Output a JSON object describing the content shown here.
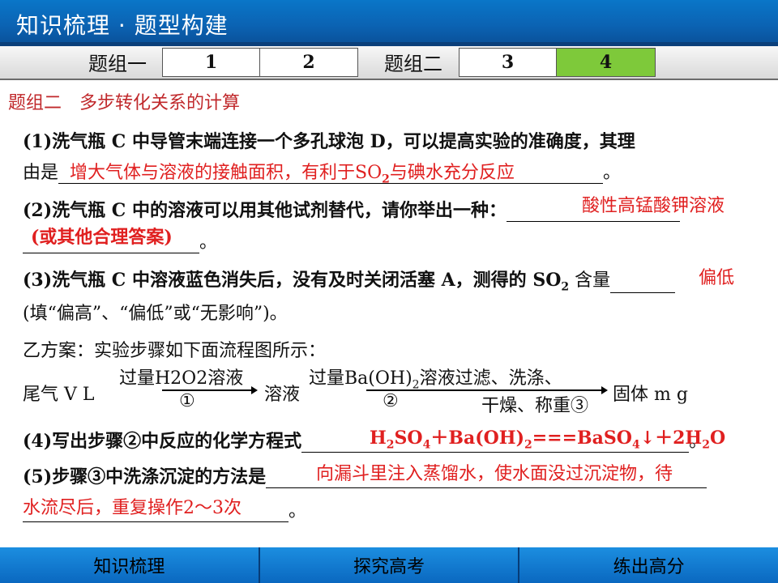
{
  "header": {
    "title": "知识梳理 · 题型构建"
  },
  "tabs": {
    "group1": "题组一",
    "t1": "1",
    "t2": "2",
    "group2": "题组二",
    "t3": "3",
    "t4": "4"
  },
  "section_title": "题组二　多步转化关系的计算",
  "q1": {
    "line1": "(1)洗气瓶 C 中导管末端连接一个多孔球泡 D，可以提高实验的准确度，其理",
    "line2_prefix": "由是",
    "answer_part1": "增大气体与溶液的接触面积，有利于SO",
    "answer_sub": "2",
    "answer_part2": "与碘水充分反应",
    "end": "。"
  },
  "q2": {
    "line1": "(2)洗气瓶 C 中的溶液可以用其他试剂替代，请你举出一种：",
    "answer1": "酸性高锰酸钾溶液",
    "answer2": "(或其他合理答案)",
    "end": "。"
  },
  "q3": {
    "line1": "(3)洗气瓶 C 中溶液蓝色消失后，没有及时关闭活塞 A，测得的 SO",
    "sub": "2",
    "tail": " 含量",
    "answer": "偏低",
    "line2": "(填“偏高”、“偏低”或“无影响”)。"
  },
  "plan_b": "乙方案：实验步骤如下面流程图所示：",
  "flow": {
    "start": "尾气 V L",
    "reagent1": "过量H2O2溶液",
    "step1": "①",
    "mid": "溶液",
    "reagent2_prefix": "过量Ba(OH)",
    "reagent2_sub": "2",
    "reagent2_suffix": "溶液过滤、洗涤、",
    "step2": "②",
    "dry": "干燥、称重③",
    "end": "固体 m g"
  },
  "q4": {
    "line1": "(4)写出步骤②中反应的化学方程式",
    "answer_html_parts": [
      "H",
      "2",
      "SO",
      "4",
      "＋Ba(OH)",
      "2",
      "===BaSO",
      "4",
      "↓＋2H",
      "2",
      "O"
    ],
    "end": "。"
  },
  "q5": {
    "line1": "(5)步骤③中洗涤沉淀的方法是",
    "answer1": "向漏斗里注入蒸馏水，使水面没过沉淀物，待",
    "answer2": "水流尽后，重复操作2～3次",
    "end": "。"
  },
  "bottom_nav": {
    "b1": "知识梳理",
    "b2": "探究高考",
    "b3": "练出高分"
  }
}
